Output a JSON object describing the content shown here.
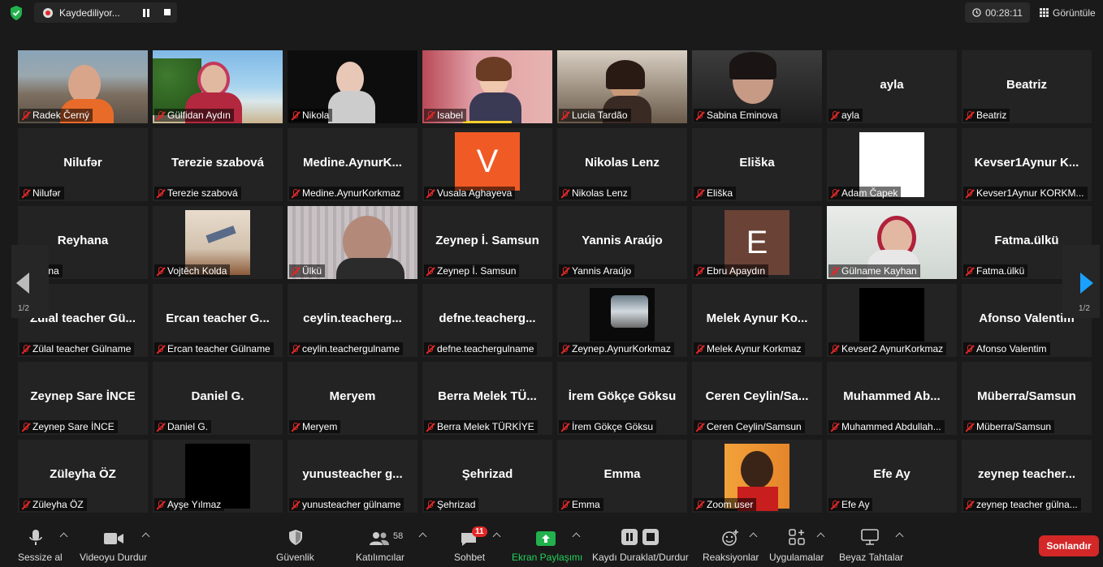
{
  "topbar": {
    "recording_label": "Kaydediliyor...",
    "timer": "00:28:11",
    "view_label": "Görüntüle"
  },
  "pagination": {
    "left": "1/2",
    "right": "1/2"
  },
  "tiles": [
    {
      "name": "",
      "label": "Radek Černý"
    },
    {
      "name": "",
      "label": "Gülfidan Aydın"
    },
    {
      "name": "",
      "label": "Nikola"
    },
    {
      "name": "",
      "label": "Isabel"
    },
    {
      "name": "",
      "label": "Lucia Tardão"
    },
    {
      "name": "",
      "label": "Sabina Eminova"
    },
    {
      "name": "ayla",
      "label": "ayla"
    },
    {
      "name": "Beatriz",
      "label": "Beatriz"
    },
    {
      "name": "Nilufər",
      "label": "Nilufər"
    },
    {
      "name": "Terezie szabová",
      "label": "Terezie szabová"
    },
    {
      "name": "Medine.AynurK...",
      "label": "Medine.AynurKorkmaz"
    },
    {
      "name": "",
      "label": "Vusala Aghayeva",
      "avatar": "V"
    },
    {
      "name": "Nikolas Lenz",
      "label": "Nikolas Lenz"
    },
    {
      "name": "Eliška",
      "label": "Eliška"
    },
    {
      "name": "",
      "label": "Adam Čapek"
    },
    {
      "name": "Kevser1Aynur K...",
      "label": "Kevser1Aynur KORKM..."
    },
    {
      "name": "Reyhana",
      "label": "yhana"
    },
    {
      "name": "",
      "label": "Vojtěch Kolda"
    },
    {
      "name": "",
      "label": "Ülkü"
    },
    {
      "name": "Zeynep İ. Samsun",
      "label": "Zeynep İ. Samsun"
    },
    {
      "name": "Yannis Araújo",
      "label": "Yannis Araújo"
    },
    {
      "name": "",
      "label": "Ebru Apaydın",
      "avatar": "E"
    },
    {
      "name": "",
      "label": "Gülname Kayhan"
    },
    {
      "name": "Fatma.ülkü",
      "label": "Fatma.ülkü"
    },
    {
      "name": "Zülal teacher Gü...",
      "label": "Zülal teacher Gülname"
    },
    {
      "name": "Ercan teacher G...",
      "label": "Ercan teacher Gülname"
    },
    {
      "name": "ceylin.teacherg...",
      "label": "ceylin.teachergulname"
    },
    {
      "name": "defne.teacherg...",
      "label": "defne.teachergulname"
    },
    {
      "name": "",
      "label": "Zeynep.AynurKorkmaz"
    },
    {
      "name": "Melek Aynur Ko...",
      "label": "Melek Aynur Korkmaz"
    },
    {
      "name": "",
      "label": "Kevser2 AynurKorkmaz"
    },
    {
      "name": "Afonso Valentim",
      "label": "Afonso Valentim"
    },
    {
      "name": "Zeynep Sare İNCE",
      "label": "Zeynep Sare İNCE"
    },
    {
      "name": "Daniel G.",
      "label": "Daniel G."
    },
    {
      "name": "Meryem",
      "label": "Meryem"
    },
    {
      "name": "Berra Melek TÜ...",
      "label": "Berra Melek TÜRKİYE"
    },
    {
      "name": "İrem Gökçe Göksu",
      "label": "İrem Gökçe Göksu"
    },
    {
      "name": "Ceren Ceylin/Sa...",
      "label": "Ceren Ceylin/Samsun"
    },
    {
      "name": "Muhammed Ab...",
      "label": "Muhammed Abdullah..."
    },
    {
      "name": "Müberra/Samsun",
      "label": "Müberra/Samsun"
    },
    {
      "name": "Züleyha ÖZ",
      "label": "Züleyha ÖZ"
    },
    {
      "name": "",
      "label": "Ayşe Yılmaz"
    },
    {
      "name": "yunusteacher g...",
      "label": "yunusteacher gülname"
    },
    {
      "name": "Şehrizad",
      "label": "Şehrizad"
    },
    {
      "name": "Emma",
      "label": "Emma"
    },
    {
      "name": "",
      "label": "Zoom user"
    },
    {
      "name": "Efe Ay",
      "label": "Efe Ay"
    },
    {
      "name": "zeynep teacher...",
      "label": "zeynep teacher gülna..."
    }
  ],
  "toolbar": {
    "mute": "Sessize al",
    "video": "Videoyu Durdur",
    "security": "Güvenlik",
    "participants": "Katılımcılar",
    "participants_count": "58",
    "chat": "Sohbet",
    "chat_badge": "11",
    "share": "Ekran Paylaşımı",
    "record": "Kaydı Duraklat/Durdur",
    "reactions": "Reaksiyonlar",
    "apps": "Uygulamalar",
    "whiteboard": "Beyaz Tahtalar",
    "end": "Sonlandır"
  },
  "colors": {
    "share_green": "#23b14d",
    "end_red": "#d42727",
    "mute_red": "#e02828",
    "active_border": "#ffd02a",
    "nav_blue": "#1aa0ff"
  }
}
